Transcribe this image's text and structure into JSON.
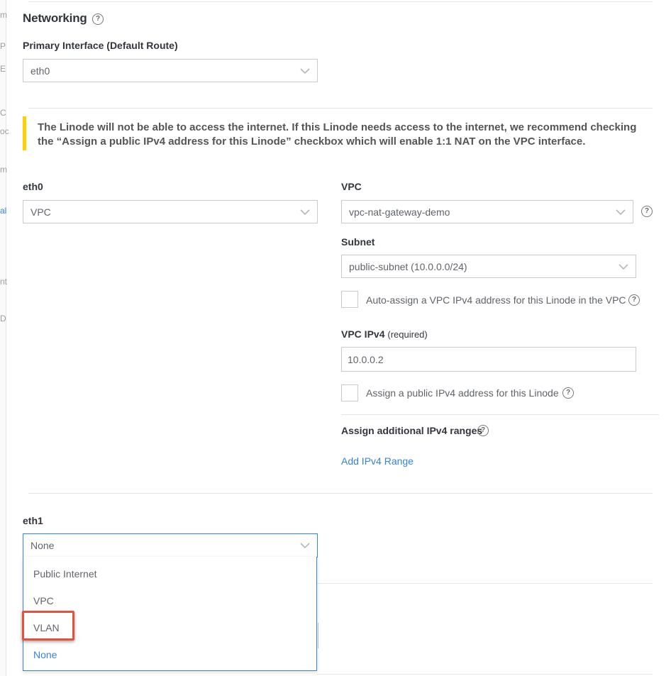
{
  "edge_fragments": [
    "m",
    "P",
    "E",
    "C",
    "oc",
    "m",
    "al",
    "nt",
    "D"
  ],
  "networking": {
    "title": "Networking",
    "primary_interface_label": "Primary Interface (Default Route)",
    "primary_interface_value": "eth0"
  },
  "notice": {
    "line1": "The Linode will not be able to access the internet. If this Linode needs access to the internet, we recommend checking",
    "line2": "the “Assign a public IPv4 address for this Linode” checkbox which will enable 1:1 NAT on the VPC interface."
  },
  "eth0": {
    "label": "eth0",
    "value": "VPC"
  },
  "vpc": {
    "label": "VPC",
    "value": "vpc-nat-gateway-demo",
    "subnet_label": "Subnet",
    "subnet_value": "public-subnet (10.0.0.0/24)",
    "auto_assign_label": "Auto-assign a VPC IPv4 address for this Linode in the VPC",
    "ipv4_label": "VPC IPv4",
    "ipv4_required": "(required)",
    "ipv4_value": "10.0.0.2",
    "public_ipv4_label": "Assign a public IPv4 address for this Linode",
    "ranges_label": "Assign additional IPv4 ranges",
    "add_range_link": "Add IPv4 Range"
  },
  "eth1": {
    "label": "eth1",
    "value": "None",
    "options": [
      {
        "label": "Public Internet",
        "selected": false
      },
      {
        "label": "VPC",
        "selected": false
      },
      {
        "label": "VLAN",
        "selected": false
      },
      {
        "label": "None",
        "selected": true
      }
    ]
  },
  "colors": {
    "accent": "#3683dc",
    "warning": "#ffd002",
    "highlight": "#e2533f"
  }
}
